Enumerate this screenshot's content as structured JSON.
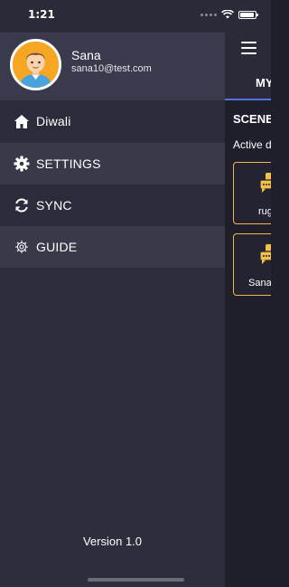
{
  "status_bar": {
    "time": "1:21"
  },
  "profile": {
    "name": "Sana",
    "email": "sana10@test.com"
  },
  "menu": {
    "items": [
      {
        "label": "Diwali",
        "icon": "home-icon"
      },
      {
        "label": "SETTINGS",
        "icon": "gear-icon"
      },
      {
        "label": "SYNC",
        "icon": "sync-icon"
      },
      {
        "label": "GUIDE",
        "icon": "gear-outline-icon"
      }
    ]
  },
  "version": "Version 1.0",
  "main": {
    "tab_label": "MY",
    "section_title": "SCENE",
    "subtitle": "Active d",
    "cards": [
      {
        "label": "rug"
      },
      {
        "label": "Sana"
      }
    ]
  },
  "colors": {
    "accent": "#4f74e0",
    "card_border": "#f1b54a",
    "icon_yellow": "#f5c04a"
  }
}
